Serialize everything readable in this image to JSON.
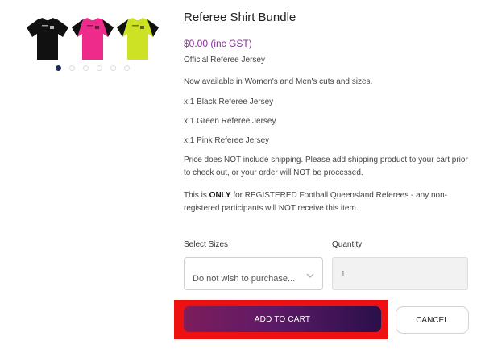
{
  "product": {
    "title": "Referee Shirt Bundle",
    "price": "$0.00 (inc GST)",
    "subtitle": "Official Referee Jersey",
    "description": [
      "Now available in Women's and Men's cuts and sizes.",
      "x 1 Black Referee Jersey",
      "x 1 Green Referee Jersey",
      "x 1 Pink Referee Jersey"
    ],
    "shipping_note": "Price does NOT include shipping. Please add shipping product to your cart prior to check out, or your order will NOT be processed.",
    "eligibility_prefix": "This is ",
    "eligibility_bold": "ONLY",
    "eligibility_suffix": " for REGISTERED Football Queensland Referees - any non-registered participants will NOT receive this item."
  },
  "gallery": {
    "shirts": [
      {
        "name": "black-shirt",
        "color": "#111111"
      },
      {
        "name": "pink-shirt",
        "color": "#ee2a8a"
      },
      {
        "name": "green-shirt",
        "color": "#cde125"
      }
    ],
    "slide_count": 6,
    "active_slide": 1
  },
  "form": {
    "sizes_label": "Select Sizes",
    "sizes_selected": "Do not wish to purchase...",
    "quantity_label": "Quantity",
    "quantity_value": "1"
  },
  "actions": {
    "add_to_cart": "ADD TO CART",
    "cancel": "CANCEL"
  },
  "colors": {
    "accent": "#8a2d9e",
    "button_gradient_start": "#7d1d5c",
    "button_gradient_end": "#2a0f4a",
    "highlight": "#ee1111"
  },
  "icons": {
    "select_chevron": "chevron-down-icon"
  }
}
